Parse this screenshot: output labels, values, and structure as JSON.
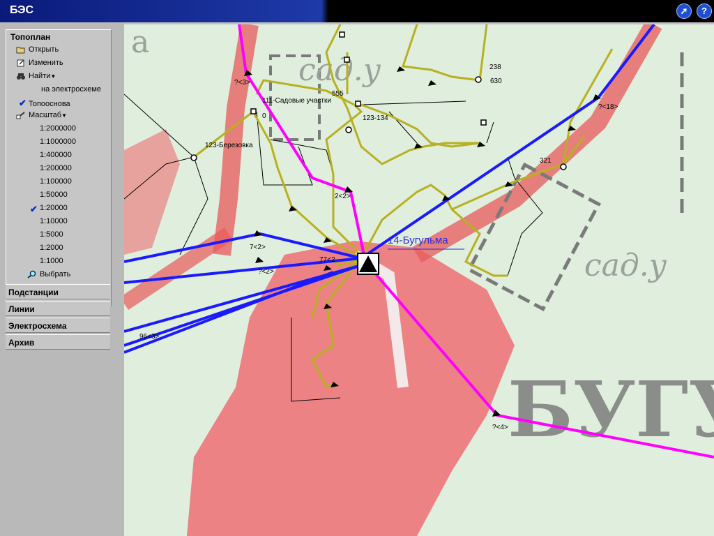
{
  "app": {
    "title": "БЭС"
  },
  "titlebar": {
    "nav_icon": "compass-icon",
    "help_icon": "help-icon",
    "help_label": "?"
  },
  "sidebar": {
    "header": "Топоплан",
    "actions": [
      {
        "label": "Открыть",
        "icon": "folder-open-icon"
      },
      {
        "label": "Изменить",
        "icon": "edit-icon"
      },
      {
        "label": "Найти",
        "icon": "binoculars-icon"
      }
    ],
    "find_sub": "на электросхеме",
    "topobase": {
      "label": "Топооснова",
      "checked": true
    },
    "scale": {
      "label": "Масштаб",
      "icon": "scale-icon"
    },
    "scales": [
      "1:2000000",
      "1:1000000",
      "1:400000",
      "1:200000",
      "1:100000",
      "1:50000",
      "1:20000",
      "1:10000",
      "1:5000",
      "1:2000",
      "1:1000"
    ],
    "selected_scale": "1:20000",
    "select": {
      "label": "Выбрать",
      "icon": "magnifier-icon"
    },
    "sections": [
      "Подстанции",
      "Линии",
      "Электросхема",
      "Архив"
    ]
  },
  "map": {
    "substation": "14-Бугульма",
    "labels": {
      "l1": "?<3>",
      "l2": "111-Садовые участки",
      "l3": "555",
      "l4": "0",
      "l5": "123-134",
      "l6": "123-Березовка",
      "l7": "238",
      "l8": "630",
      "l9": "?<18>",
      "l10": "321",
      "l11": "2<2>",
      "l12": "7<2>",
      "l13": "?<2>",
      "l14": "77<2",
      "l15": "96<3>",
      "l16": "?<4>"
    },
    "background_text": {
      "t1": "сад.у",
      "t2": "сад.у",
      "t3": "БУГУ",
      "t4": "а"
    },
    "colors": {
      "line_110": "#1a1aff",
      "line_35": "#ff00ff",
      "line_10": "#b8b020",
      "land": "#dfeedd",
      "urban": "#ee6f73"
    }
  }
}
